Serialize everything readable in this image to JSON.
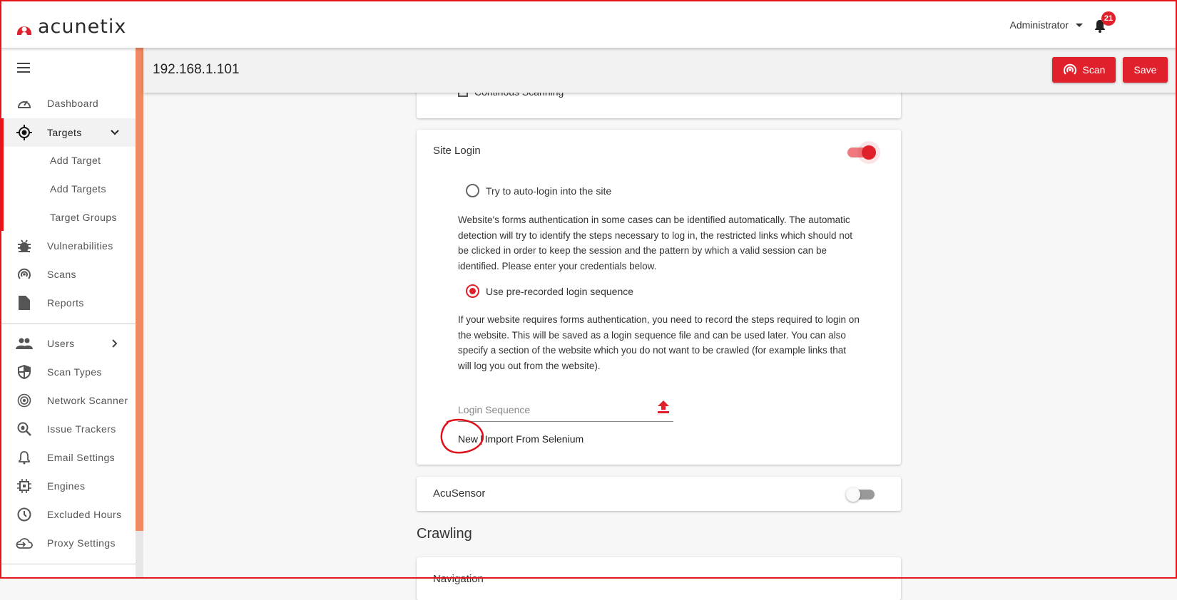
{
  "header": {
    "brand": "acunetix",
    "user": "Administrator",
    "notifications": "21"
  },
  "sidebar": {
    "items": [
      {
        "label": "Dashboard",
        "icon": "gauge-icon"
      },
      {
        "label": "Targets",
        "icon": "target-icon",
        "active": true
      },
      {
        "label": "Add Target"
      },
      {
        "label": "Add Targets"
      },
      {
        "label": "Target Groups"
      },
      {
        "label": "Vulnerabilities",
        "icon": "bug-icon"
      },
      {
        "label": "Scans",
        "icon": "radar-icon"
      },
      {
        "label": "Reports",
        "icon": "file-icon"
      },
      {
        "label": "Users",
        "icon": "users-icon"
      },
      {
        "label": "Scan Types",
        "icon": "shield-icon"
      },
      {
        "label": "Network Scanner",
        "icon": "network-icon"
      },
      {
        "label": "Issue Trackers",
        "icon": "bug-search-icon"
      },
      {
        "label": "Email Settings",
        "icon": "bell-icon"
      },
      {
        "label": "Engines",
        "icon": "chip-icon"
      },
      {
        "label": "Excluded Hours",
        "icon": "clock-icon"
      },
      {
        "label": "Proxy Settings",
        "icon": "cloud-icon"
      }
    ]
  },
  "titlebar": {
    "title": "192.168.1.101",
    "scan_label": "Scan",
    "save_label": "Save"
  },
  "main": {
    "continuous": "Continous Scanning",
    "site_login": {
      "title": "Site Login",
      "enabled": true,
      "option1": "Try to auto-login into the site",
      "desc1": "Website's forms authentication in some cases can be identified automatically. The automatic detection will try to identify the steps necessary to log in, the restricted links which should not be clicked in order to keep the session and the pattern by which a valid session can be identified. Please enter your credentials below.",
      "option2": "Use pre-recorded login sequence",
      "selected": "option2",
      "desc2": "If your website requires forms authentication, you need to record the steps required to login on the website. This will be saved as a login sequence file and can be used later. You can also specify a section of the website which you do not want to be crawled (for example links that will log you out from the website).",
      "field_placeholder": "Login Sequence",
      "new_link": "New",
      "separator": "|",
      "import_link": "Import From Selenium"
    },
    "acusensor": {
      "title": "AcuSensor",
      "enabled": false
    },
    "crawling_heading": "Crawling",
    "navigation_title": "Navigation"
  },
  "colors": {
    "accent": "#e0202a",
    "scrollbar": "#ef8a63"
  }
}
